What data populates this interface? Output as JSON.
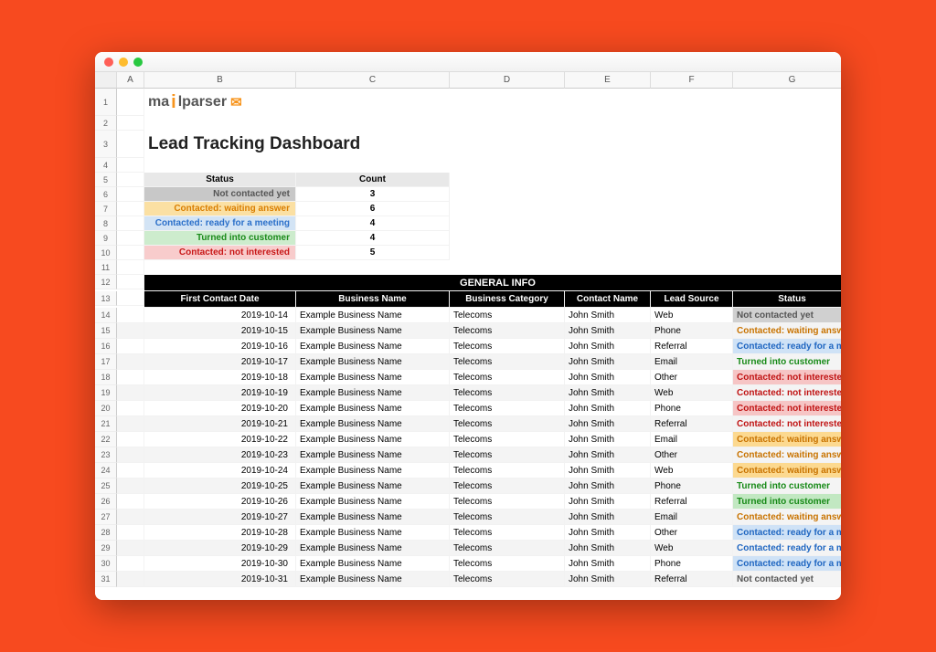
{
  "logo": {
    "text_a": "ma",
    "text_i": "i",
    "text_l": "lparser",
    "icon": "✉"
  },
  "title": "Lead Tracking Dashboard",
  "columns": [
    "",
    "A",
    "B",
    "C",
    "D",
    "E",
    "F",
    "G"
  ],
  "summary": {
    "header_status": "Status",
    "header_count": "Count",
    "rows": [
      {
        "label": "Not contacted yet",
        "count": "3",
        "cls": "bg-grey"
      },
      {
        "label": "Contacted: waiting answer",
        "count": "6",
        "cls": "bg-yel"
      },
      {
        "label": "Contacted: ready for a meeting",
        "count": "4",
        "cls": "bg-blue"
      },
      {
        "label": "Turned into customer",
        "count": "4",
        "cls": "bg-grn"
      },
      {
        "label": "Contacted: not interested",
        "count": "5",
        "cls": "bg-red"
      }
    ]
  },
  "general_info_label": "GENERAL INFO",
  "lead_headers": [
    "First Contact Date",
    "Business Name",
    "Business Category",
    "Contact Name",
    "Lead Source",
    "Status"
  ],
  "status_classes": {
    "Not contacted yet": "st-grey",
    "Contacted: waiting answer": "st-yel",
    "Contacted: ready for a meeting": "st-blue",
    "Turned into customer": "st-grn",
    "Contacted: not interested": "st-red"
  },
  "leads": [
    {
      "r": 14,
      "date": "2019-10-14",
      "biz": "Example Business Name",
      "cat": "Telecoms",
      "contact": "John Smith",
      "src": "Web",
      "status": "Not contacted yet"
    },
    {
      "r": 15,
      "date": "2019-10-15",
      "biz": "Example Business Name",
      "cat": "Telecoms",
      "contact": "John Smith",
      "src": "Phone",
      "status": "Contacted: waiting answer"
    },
    {
      "r": 16,
      "date": "2019-10-16",
      "biz": "Example Business Name",
      "cat": "Telecoms",
      "contact": "John Smith",
      "src": "Referral",
      "status": "Contacted: ready for a meeting"
    },
    {
      "r": 17,
      "date": "2019-10-17",
      "biz": "Example Business Name",
      "cat": "Telecoms",
      "contact": "John Smith",
      "src": "Email",
      "status": "Turned into customer"
    },
    {
      "r": 18,
      "date": "2019-10-18",
      "biz": "Example Business Name",
      "cat": "Telecoms",
      "contact": "John Smith",
      "src": "Other",
      "status": "Contacted: not interested"
    },
    {
      "r": 19,
      "date": "2019-10-19",
      "biz": "Example Business Name",
      "cat": "Telecoms",
      "contact": "John Smith",
      "src": "Web",
      "status": "Contacted: not interested"
    },
    {
      "r": 20,
      "date": "2019-10-20",
      "biz": "Example Business Name",
      "cat": "Telecoms",
      "contact": "John Smith",
      "src": "Phone",
      "status": "Contacted: not interested"
    },
    {
      "r": 21,
      "date": "2019-10-21",
      "biz": "Example Business Name",
      "cat": "Telecoms",
      "contact": "John Smith",
      "src": "Referral",
      "status": "Contacted: not interested"
    },
    {
      "r": 22,
      "date": "2019-10-22",
      "biz": "Example Business Name",
      "cat": "Telecoms",
      "contact": "John Smith",
      "src": "Email",
      "status": "Contacted: waiting answer"
    },
    {
      "r": 23,
      "date": "2019-10-23",
      "biz": "Example Business Name",
      "cat": "Telecoms",
      "contact": "John Smith",
      "src": "Other",
      "status": "Contacted: waiting answer"
    },
    {
      "r": 24,
      "date": "2019-10-24",
      "biz": "Example Business Name",
      "cat": "Telecoms",
      "contact": "John Smith",
      "src": "Web",
      "status": "Contacted: waiting answer"
    },
    {
      "r": 25,
      "date": "2019-10-25",
      "biz": "Example Business Name",
      "cat": "Telecoms",
      "contact": "John Smith",
      "src": "Phone",
      "status": "Turned into customer"
    },
    {
      "r": 26,
      "date": "2019-10-26",
      "biz": "Example Business Name",
      "cat": "Telecoms",
      "contact": "John Smith",
      "src": "Referral",
      "status": "Turned into customer"
    },
    {
      "r": 27,
      "date": "2019-10-27",
      "biz": "Example Business Name",
      "cat": "Telecoms",
      "contact": "John Smith",
      "src": "Email",
      "status": "Contacted: waiting answer"
    },
    {
      "r": 28,
      "date": "2019-10-28",
      "biz": "Example Business Name",
      "cat": "Telecoms",
      "contact": "John Smith",
      "src": "Other",
      "status": "Contacted: ready for a meeting"
    },
    {
      "r": 29,
      "date": "2019-10-29",
      "biz": "Example Business Name",
      "cat": "Telecoms",
      "contact": "John Smith",
      "src": "Web",
      "status": "Contacted: ready for a meeting"
    },
    {
      "r": 30,
      "date": "2019-10-30",
      "biz": "Example Business Name",
      "cat": "Telecoms",
      "contact": "John Smith",
      "src": "Phone",
      "status": "Contacted: ready for a meeting"
    },
    {
      "r": 31,
      "date": "2019-10-31",
      "biz": "Example Business Name",
      "cat": "Telecoms",
      "contact": "John Smith",
      "src": "Referral",
      "status": "Not contacted yet"
    }
  ]
}
